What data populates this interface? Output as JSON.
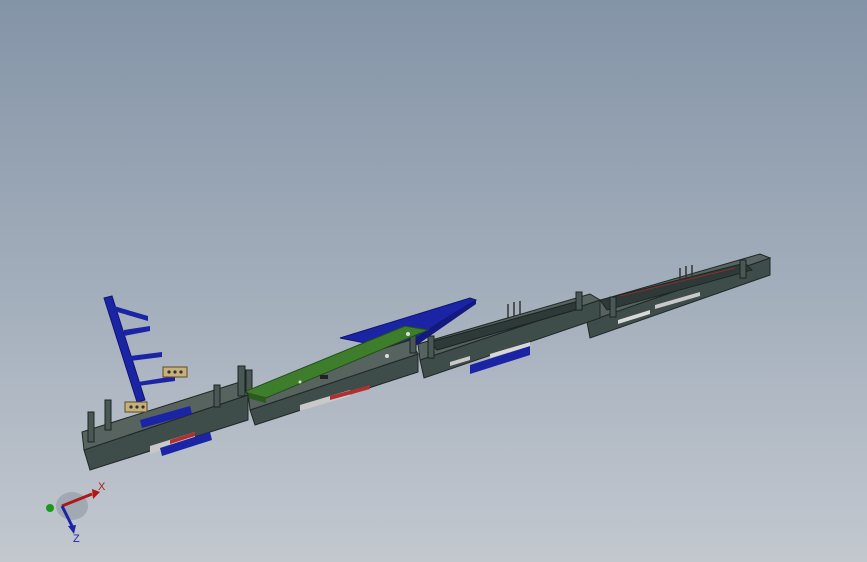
{
  "viewport": {
    "background_top": "#8494a7",
    "background_bottom": "#c3c8cf"
  },
  "model": {
    "module_color": "#3e4c4a",
    "module_edge_color": "#202826",
    "bracket_color": "#1c24a6",
    "pcb_color": "#3e7d2c",
    "connector_color": "#c8b07a"
  },
  "triad": {
    "x_label": "X",
    "z_label": "Z",
    "x_color": "#b01818",
    "y_color": "#1a9a1a",
    "z_color": "#1c24a6"
  }
}
